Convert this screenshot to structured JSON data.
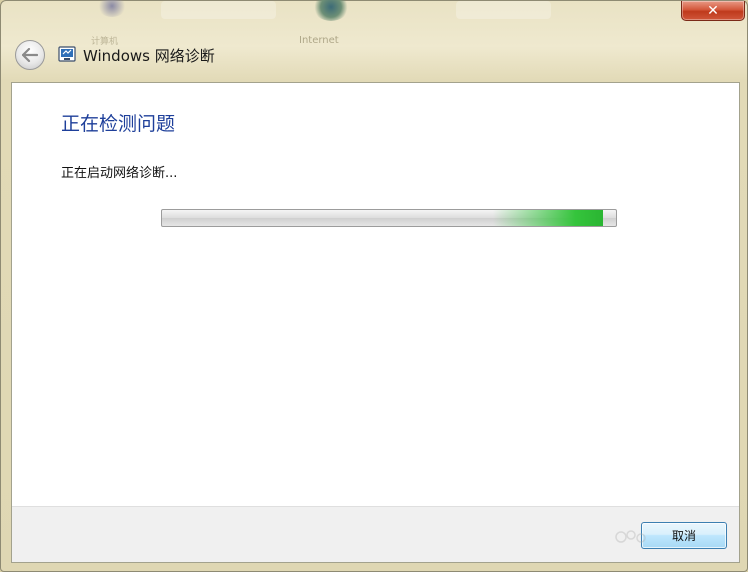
{
  "background": {
    "desktop_icon_1_label": "计算机",
    "desktop_icon_2_label": "Internet"
  },
  "window": {
    "title": "Windows 网络诊断",
    "close_glyph": "✕",
    "back_icon": "back-arrow-icon",
    "title_icon": "network-diagnostics-icon"
  },
  "content": {
    "heading": "正在检测问题",
    "status": "正在启动网络诊断..."
  },
  "progress": {
    "mode": "indeterminate",
    "glow_position": 0.85
  },
  "footer": {
    "cancel_label": "取消"
  },
  "colors": {
    "heading": "#1e3f9a",
    "progress_glow": "#35c43c",
    "close_button": "#d4583c"
  }
}
